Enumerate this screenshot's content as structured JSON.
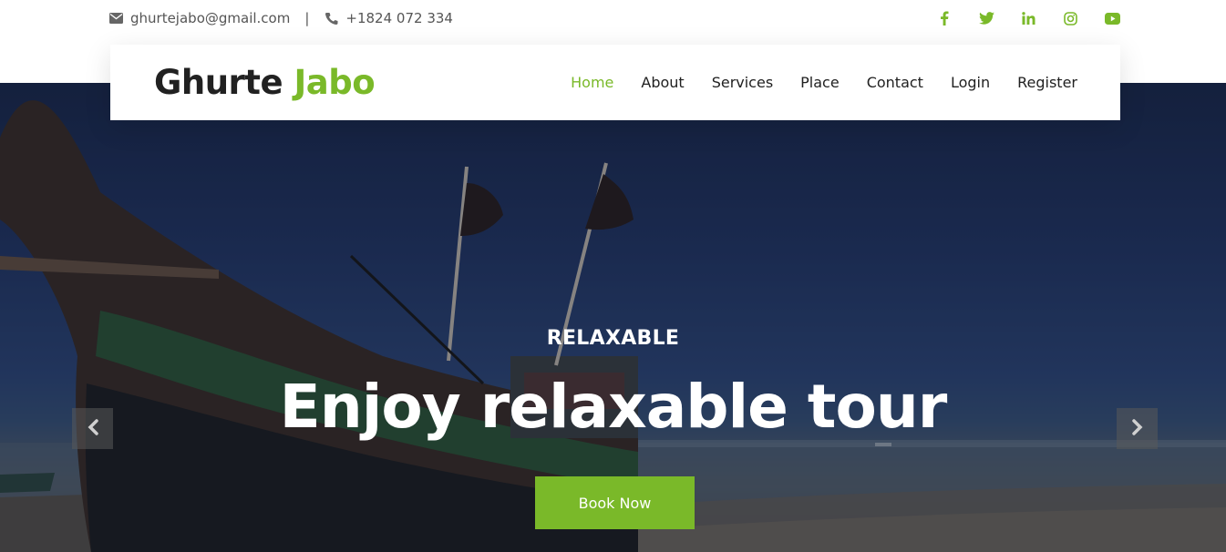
{
  "topbar": {
    "email": "ghurtejabo@gmail.com",
    "separator": "|",
    "phone": "+1824 072 334",
    "icons": [
      "envelope-icon",
      "phone-icon"
    ],
    "social": [
      "facebook-icon",
      "twitter-icon",
      "linkedin-icon",
      "instagram-icon",
      "youtube-icon"
    ]
  },
  "brand": {
    "part1": "Ghurte",
    "part2": "Jabo"
  },
  "nav": {
    "items": [
      {
        "label": "Home",
        "active": true
      },
      {
        "label": "About"
      },
      {
        "label": "Services"
      },
      {
        "label": "Place"
      },
      {
        "label": "Contact"
      },
      {
        "label": "Login"
      },
      {
        "label": "Register"
      }
    ]
  },
  "hero": {
    "kicker": "RELAXABLE",
    "headline": "Enjoy relaxable tour",
    "cta": "Book Now",
    "prev_icon": "chevron-left-icon",
    "next_icon": "chevron-right-icon"
  },
  "colors": {
    "accent": "#7ab929",
    "dark": "#212121",
    "white": "#ffffff"
  }
}
